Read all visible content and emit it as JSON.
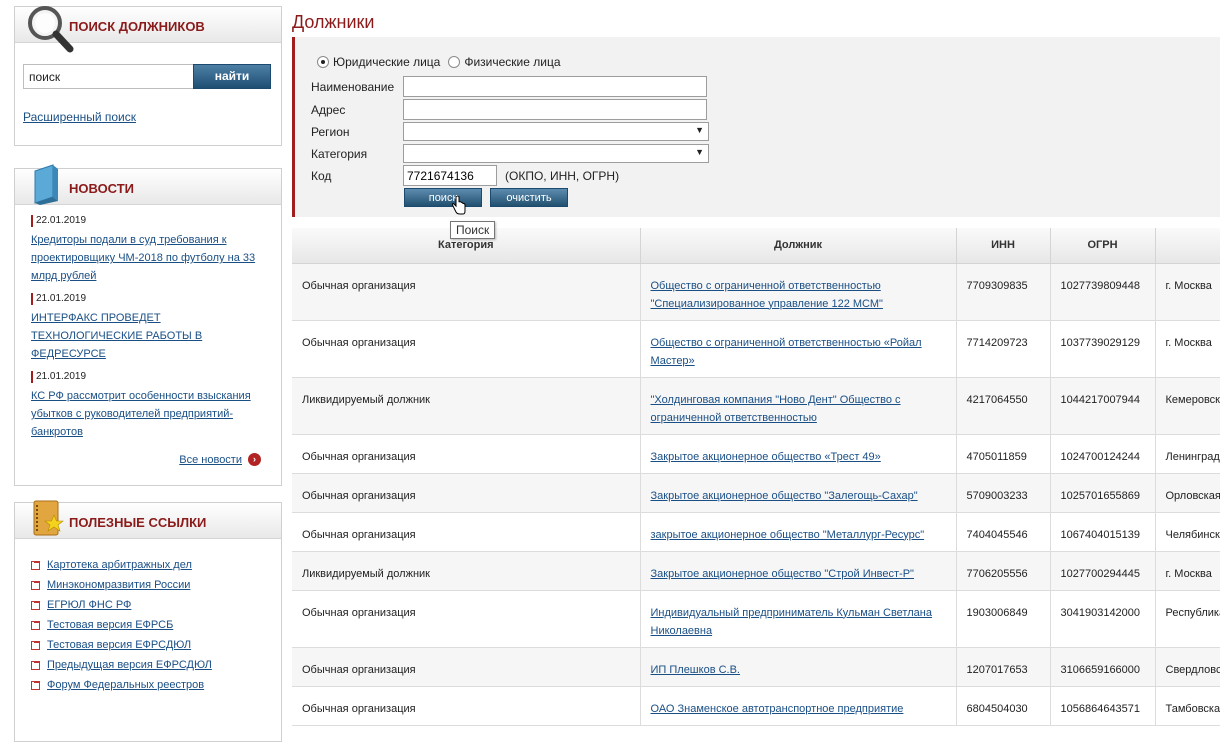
{
  "search_panel": {
    "title": "Поиск должников",
    "input_value": "поиск",
    "button_label": "найти",
    "advanced_link": "Расширенный поиск"
  },
  "news_panel": {
    "title": "Новости",
    "items": [
      {
        "date": "22.01.2019",
        "title": "Кредиторы подали в суд требования к проектировщику ЧМ-2018 по футболу на 33 млрд рублей"
      },
      {
        "date": "21.01.2019",
        "title": "ИНТЕРФАКС ПРОВЕДЕТ ТЕХНОЛОГИЧЕСКИЕ РАБОТЫ В ФЕДРЕСУРСЕ"
      },
      {
        "date": "21.01.2019",
        "title": "КС РФ рассмотрит особенности взыскания убытков с руководителей предприятий-банкротов"
      }
    ],
    "all_news_label": "Все новости"
  },
  "links_panel": {
    "title": "Полезные ссылки",
    "items": [
      "Картотека арбитражных дел",
      "Минэкономразвития России",
      "ЕГРЮЛ ФНС РФ",
      "Тестовая версия ЕФРСБ",
      "Тестовая версия ЕФРСДЮЛ",
      "Предыдущая версия ЕФРСДЮЛ",
      "Форум Федеральных реестров"
    ]
  },
  "page": {
    "title": "Должники"
  },
  "form": {
    "radio_legal": "Юридические лица",
    "radio_individual": "Физические лица",
    "label_name": "Наименование",
    "label_address": "Адрес",
    "label_region": "Регион",
    "label_category": "Категория",
    "label_code": "Код",
    "code_value": "7721674136",
    "code_hint": "(ОКПО, ИНН, ОГРН)",
    "search_button": "поиск",
    "clear_button": "очистить",
    "tooltip": "Поиск"
  },
  "table": {
    "headers": [
      "Категория",
      "Должник",
      "ИНН",
      "ОГРН",
      ""
    ],
    "rows": [
      {
        "category": "Обычная организация",
        "debtor": "Общество с ограниченной ответственностью \"Специализированное управление 122 МСМ\"",
        "inn": "7709309835",
        "ogrn": "1027739809448",
        "region": "г. Москва"
      },
      {
        "category": "Обычная организация",
        "debtor": "Общество с ограниченной ответственностью «Ройал Мастер»",
        "inn": "7714209723",
        "ogrn": "1037739029129",
        "region": "г. Москва"
      },
      {
        "category": "Ликвидируемый должник",
        "debtor": "\"Холдинговая компания \"Ново Дент\" Общество с ограниченной ответственностью",
        "inn": "4217064550",
        "ogrn": "1044217007944",
        "region": "Кемеровск"
      },
      {
        "category": "Обычная организация",
        "debtor": "Закрытое акционерное общество «Трест 49»",
        "inn": "4705011859",
        "ogrn": "1024700124244",
        "region": "Ленинград"
      },
      {
        "category": "Обычная организация",
        "debtor": "Закрытое акционерное общество \"Залегощь-Сахар\"",
        "inn": "5709003233",
        "ogrn": "1025701655869",
        "region": "Орловская"
      },
      {
        "category": "Обычная организация",
        "debtor": "закрытое акционерное общество \"Металлург-Ресурс\"",
        "inn": "7404045546",
        "ogrn": "1067404015139",
        "region": "Челябинск"
      },
      {
        "category": "Ликвидируемый должник",
        "debtor": "Закрытое акционерное общество \"Строй Инвест-Р\"",
        "inn": "7706205556",
        "ogrn": "1027700294445",
        "region": "г. Москва"
      },
      {
        "category": "Обычная организация",
        "debtor": "Индивидуальный предприниматель Кульман Светлана Николаевна",
        "inn": "1903006849",
        "ogrn": "3041903142000",
        "region": "Республика"
      },
      {
        "category": "Обычная организация",
        "debtor": "ИП Плешков С.В.",
        "inn": "1207017653",
        "ogrn": "3106659166000",
        "region": "Свердловс"
      },
      {
        "category": "Обычная организация",
        "debtor": "ОАО Знаменское автотранспортное предприятие",
        "inn": "6804504030",
        "ogrn": "1056864643571",
        "region": "Тамбовска"
      }
    ]
  },
  "colors": {
    "accent_red": "#8b1a1a",
    "link_blue": "#1a4f86",
    "button_blue": "#1f4e73"
  }
}
